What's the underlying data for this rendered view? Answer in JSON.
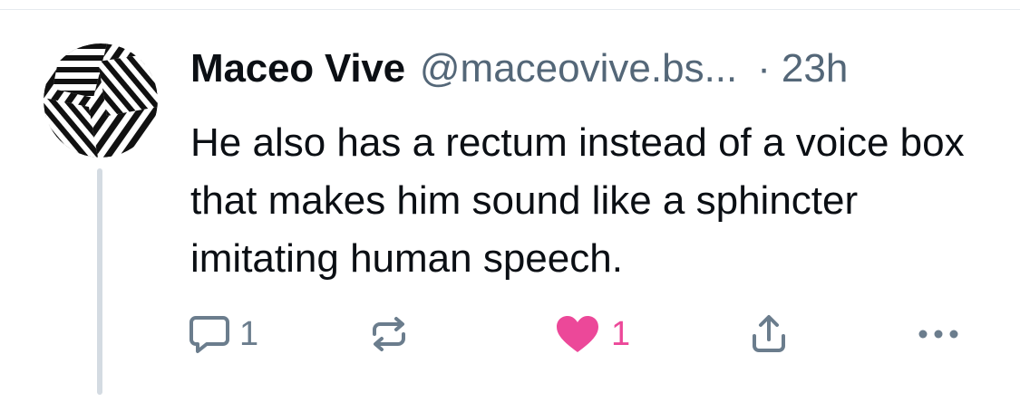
{
  "post": {
    "author_name": "Maceo Vive",
    "handle": "@maceovive.bs...",
    "separator": "·",
    "time": "23h",
    "text": "He also has a rectum instead of a voice box that makes him sound like a sphincter imitating human speech."
  },
  "actions": {
    "reply_count": "1",
    "like_count": "1"
  },
  "colors": {
    "text": "#0b0f14",
    "muted": "#546778",
    "icon": "#6b7d8d",
    "like": "#ec4899",
    "thread_line": "#d4dbe2"
  },
  "icons": {
    "avatar": "black-white-op-art-avatar",
    "reply": "speech-bubble-icon",
    "repost": "repost-arrows-icon",
    "like": "heart-filled-icon",
    "share": "share-upload-icon",
    "more": "ellipsis-icon"
  }
}
